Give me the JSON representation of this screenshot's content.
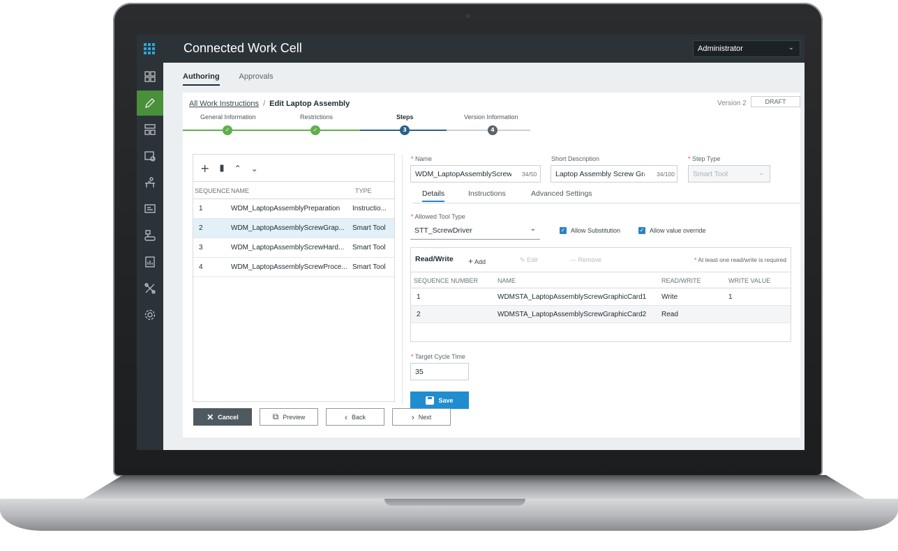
{
  "app": {
    "title": "Connected Work Cell",
    "user": "Administrator"
  },
  "top_tabs": [
    {
      "label": "Authoring",
      "active": true
    },
    {
      "label": "Approvals",
      "active": false
    }
  ],
  "breadcrumb": {
    "root": "All Work Instructions",
    "separator": "/",
    "current": "Edit Laptop Assembly"
  },
  "version": {
    "label": "Version 2",
    "status": "DRAFT"
  },
  "stepper": [
    {
      "label": "General Information",
      "state": "complete",
      "marker": ""
    },
    {
      "label": "Restrictions",
      "state": "complete",
      "marker": ""
    },
    {
      "label": "Steps",
      "state": "current",
      "marker": "3"
    },
    {
      "label": "Version Information",
      "state": "pending",
      "marker": "4"
    }
  ],
  "steplist": {
    "columns": {
      "sequence": "SEQUENCE",
      "name": "NAME",
      "type": "TYPE"
    },
    "rows": [
      {
        "sequence": "1",
        "name": "WDM_LaptopAssemblyPreparation",
        "type": "Instructio..."
      },
      {
        "sequence": "2",
        "name": "WDM_LaptopAssemblyScrewGrap...",
        "type": "Smart Tool"
      },
      {
        "sequence": "3",
        "name": "WDM_LaptopAssemblyScrewHard...",
        "type": "Smart Tool"
      },
      {
        "sequence": "4",
        "name": "WDM_LaptopAssemblyScrewProce...",
        "type": "Smart Tool"
      }
    ]
  },
  "form": {
    "name_label": "Name",
    "name_value": "WDM_LaptopAssemblyScrewGra|",
    "name_counter": "34/50",
    "short_desc_label": "Short Description",
    "short_desc_value": "Laptop Assembly Screw Graphic",
    "short_desc_counter": "34/100",
    "step_type_label": "Step Type",
    "step_type_value": "Smart Tool",
    "sub_tabs": [
      "Details",
      "Instructions",
      "Advanced Settings"
    ],
    "tool_type_label": "Allowed Tool Type",
    "tool_type_value": "STT_ScrewDriver",
    "allow_substitution": "Allow Substitution",
    "allow_override": "Allow value override",
    "rw_title": "Read/Write",
    "rw_add": "Add",
    "rw_edit": "Edit",
    "rw_remove": "Remove",
    "rw_note": "At least one read/write is required",
    "rw_columns": {
      "seq": "SEQUENCE NUMBER",
      "name": "NAME",
      "rw": "READ/WRITE",
      "value": "WRITE VALUE"
    },
    "rw_rows": [
      {
        "seq": "1",
        "name": "WDMSTA_LaptopAssemblyScrewGraphicCard1",
        "rw": "Write",
        "value": "1"
      },
      {
        "seq": "2",
        "name": "WDMSTA_LaptopAssemblyScrewGraphicCard2",
        "rw": "Read",
        "value": ""
      }
    ],
    "cycle_time_label": "Target Cycle Time",
    "cycle_time_value": "35",
    "save_label": "Save"
  },
  "buttons": {
    "cancel": "Cancel",
    "preview": "Preview",
    "back": "Back",
    "next": "Next"
  },
  "colors": {
    "complete": "#5fb04a",
    "current": "#2b5f8a",
    "pending": "#5a6368",
    "accent": "#1f8dd0"
  }
}
